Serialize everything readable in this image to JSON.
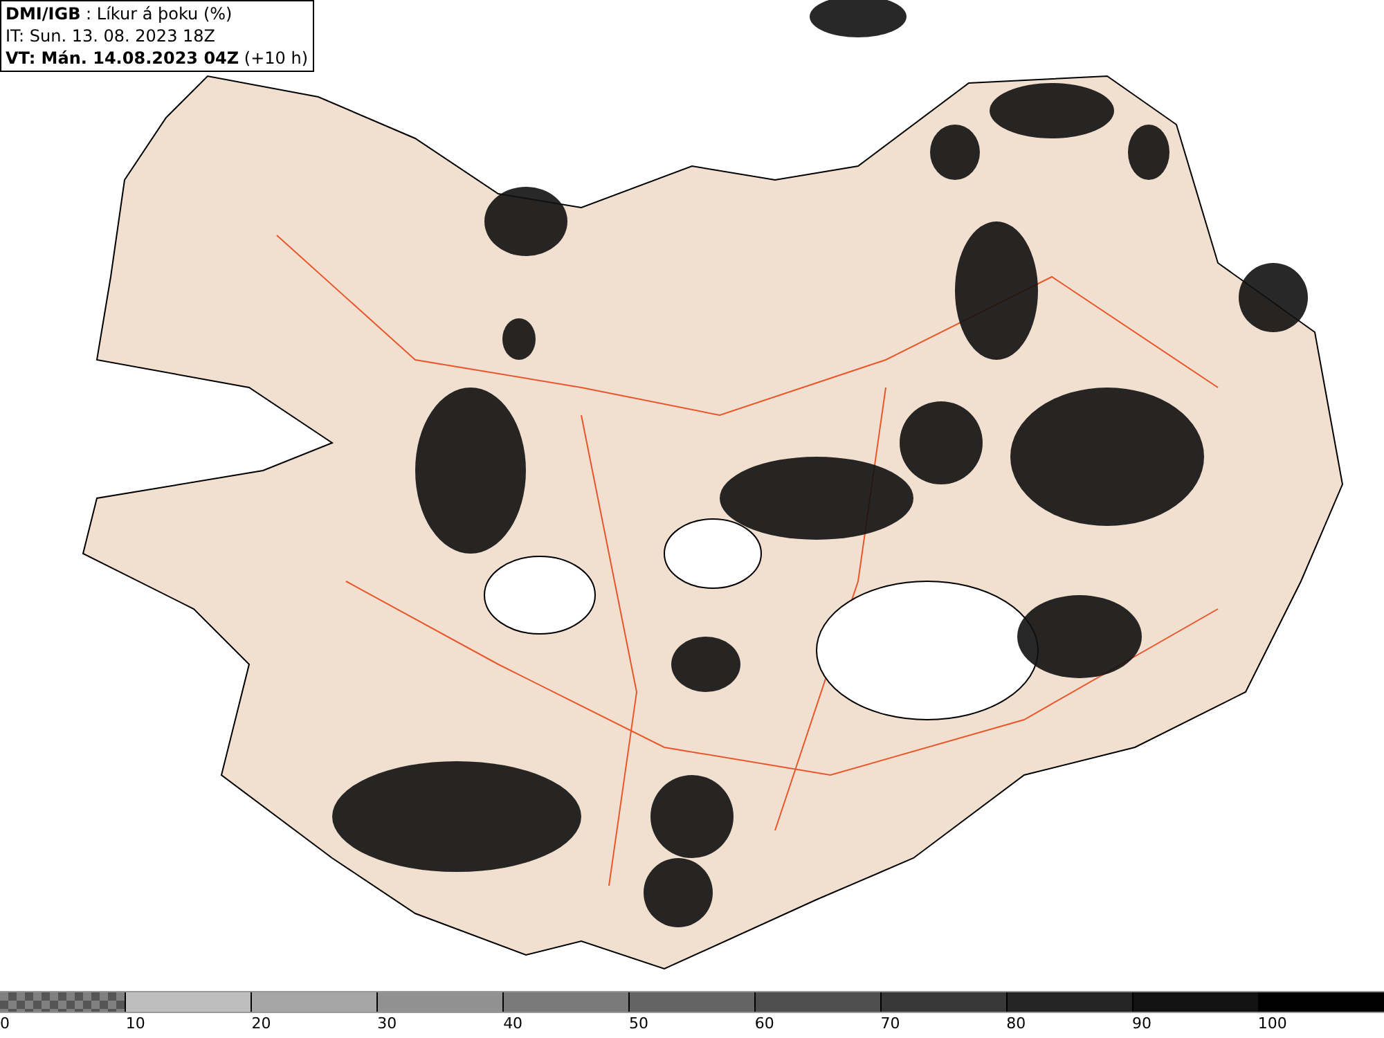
{
  "header": {
    "lines": [
      "**DMI/IGB** : Líkur á þoku (%)",
      "IT: Sun. 13. 08. 2023 18Z",
      "**VT: Mán. 14.08.2023 04Z** (+10 h)"
    ]
  },
  "legend": {
    "segments": [
      {
        "kind": "checker",
        "color": "#808080"
      },
      {
        "kind": "solid",
        "color": "#bdbdbd"
      },
      {
        "kind": "solid",
        "color": "#a6a6a6"
      },
      {
        "kind": "solid",
        "color": "#919191"
      },
      {
        "kind": "solid",
        "color": "#7a7a7a"
      },
      {
        "kind": "solid",
        "color": "#646464"
      },
      {
        "kind": "solid",
        "color": "#4e4e4e"
      },
      {
        "kind": "solid",
        "color": "#383838"
      },
      {
        "kind": "solid",
        "color": "#242424"
      },
      {
        "kind": "solid",
        "color": "#121212"
      },
      {
        "kind": "solid",
        "color": "#000000"
      }
    ],
    "labels": [
      "0",
      "10",
      "20",
      "30",
      "40",
      "50",
      "60",
      "70",
      "80",
      "90",
      "100"
    ]
  }
}
